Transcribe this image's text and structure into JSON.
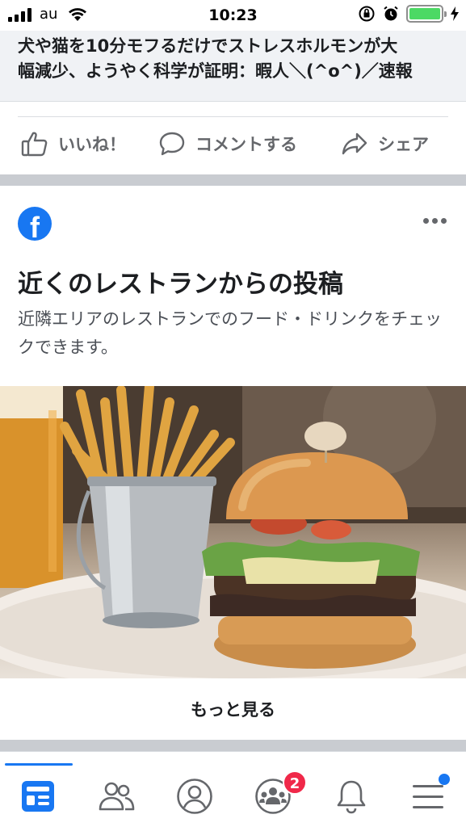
{
  "status_bar": {
    "carrier": "au",
    "time": "10:23"
  },
  "news": {
    "title_line1": "犬や猫を10分モフるだけでストレスホルモンが大",
    "title_line2": "幅減少、ようやく科学が証明：暇人＼(^o^)／速報"
  },
  "actions": {
    "like": "いいね！",
    "comment": "コメントする",
    "share": "シェア"
  },
  "card": {
    "title": "近くのレストランからの投稿",
    "description": "近隣エリアのレストランでのフード・ドリンクをチェックできます。",
    "logo_letter": "f",
    "see_more": "もっと見る"
  },
  "bottom_nav": {
    "items": [
      "news-feed",
      "friends",
      "profile",
      "groups",
      "notifications",
      "menu"
    ],
    "groups_badge": "2"
  },
  "colors": {
    "accent": "#1877f2",
    "badge": "#f02849",
    "battery": "#4cd964"
  }
}
